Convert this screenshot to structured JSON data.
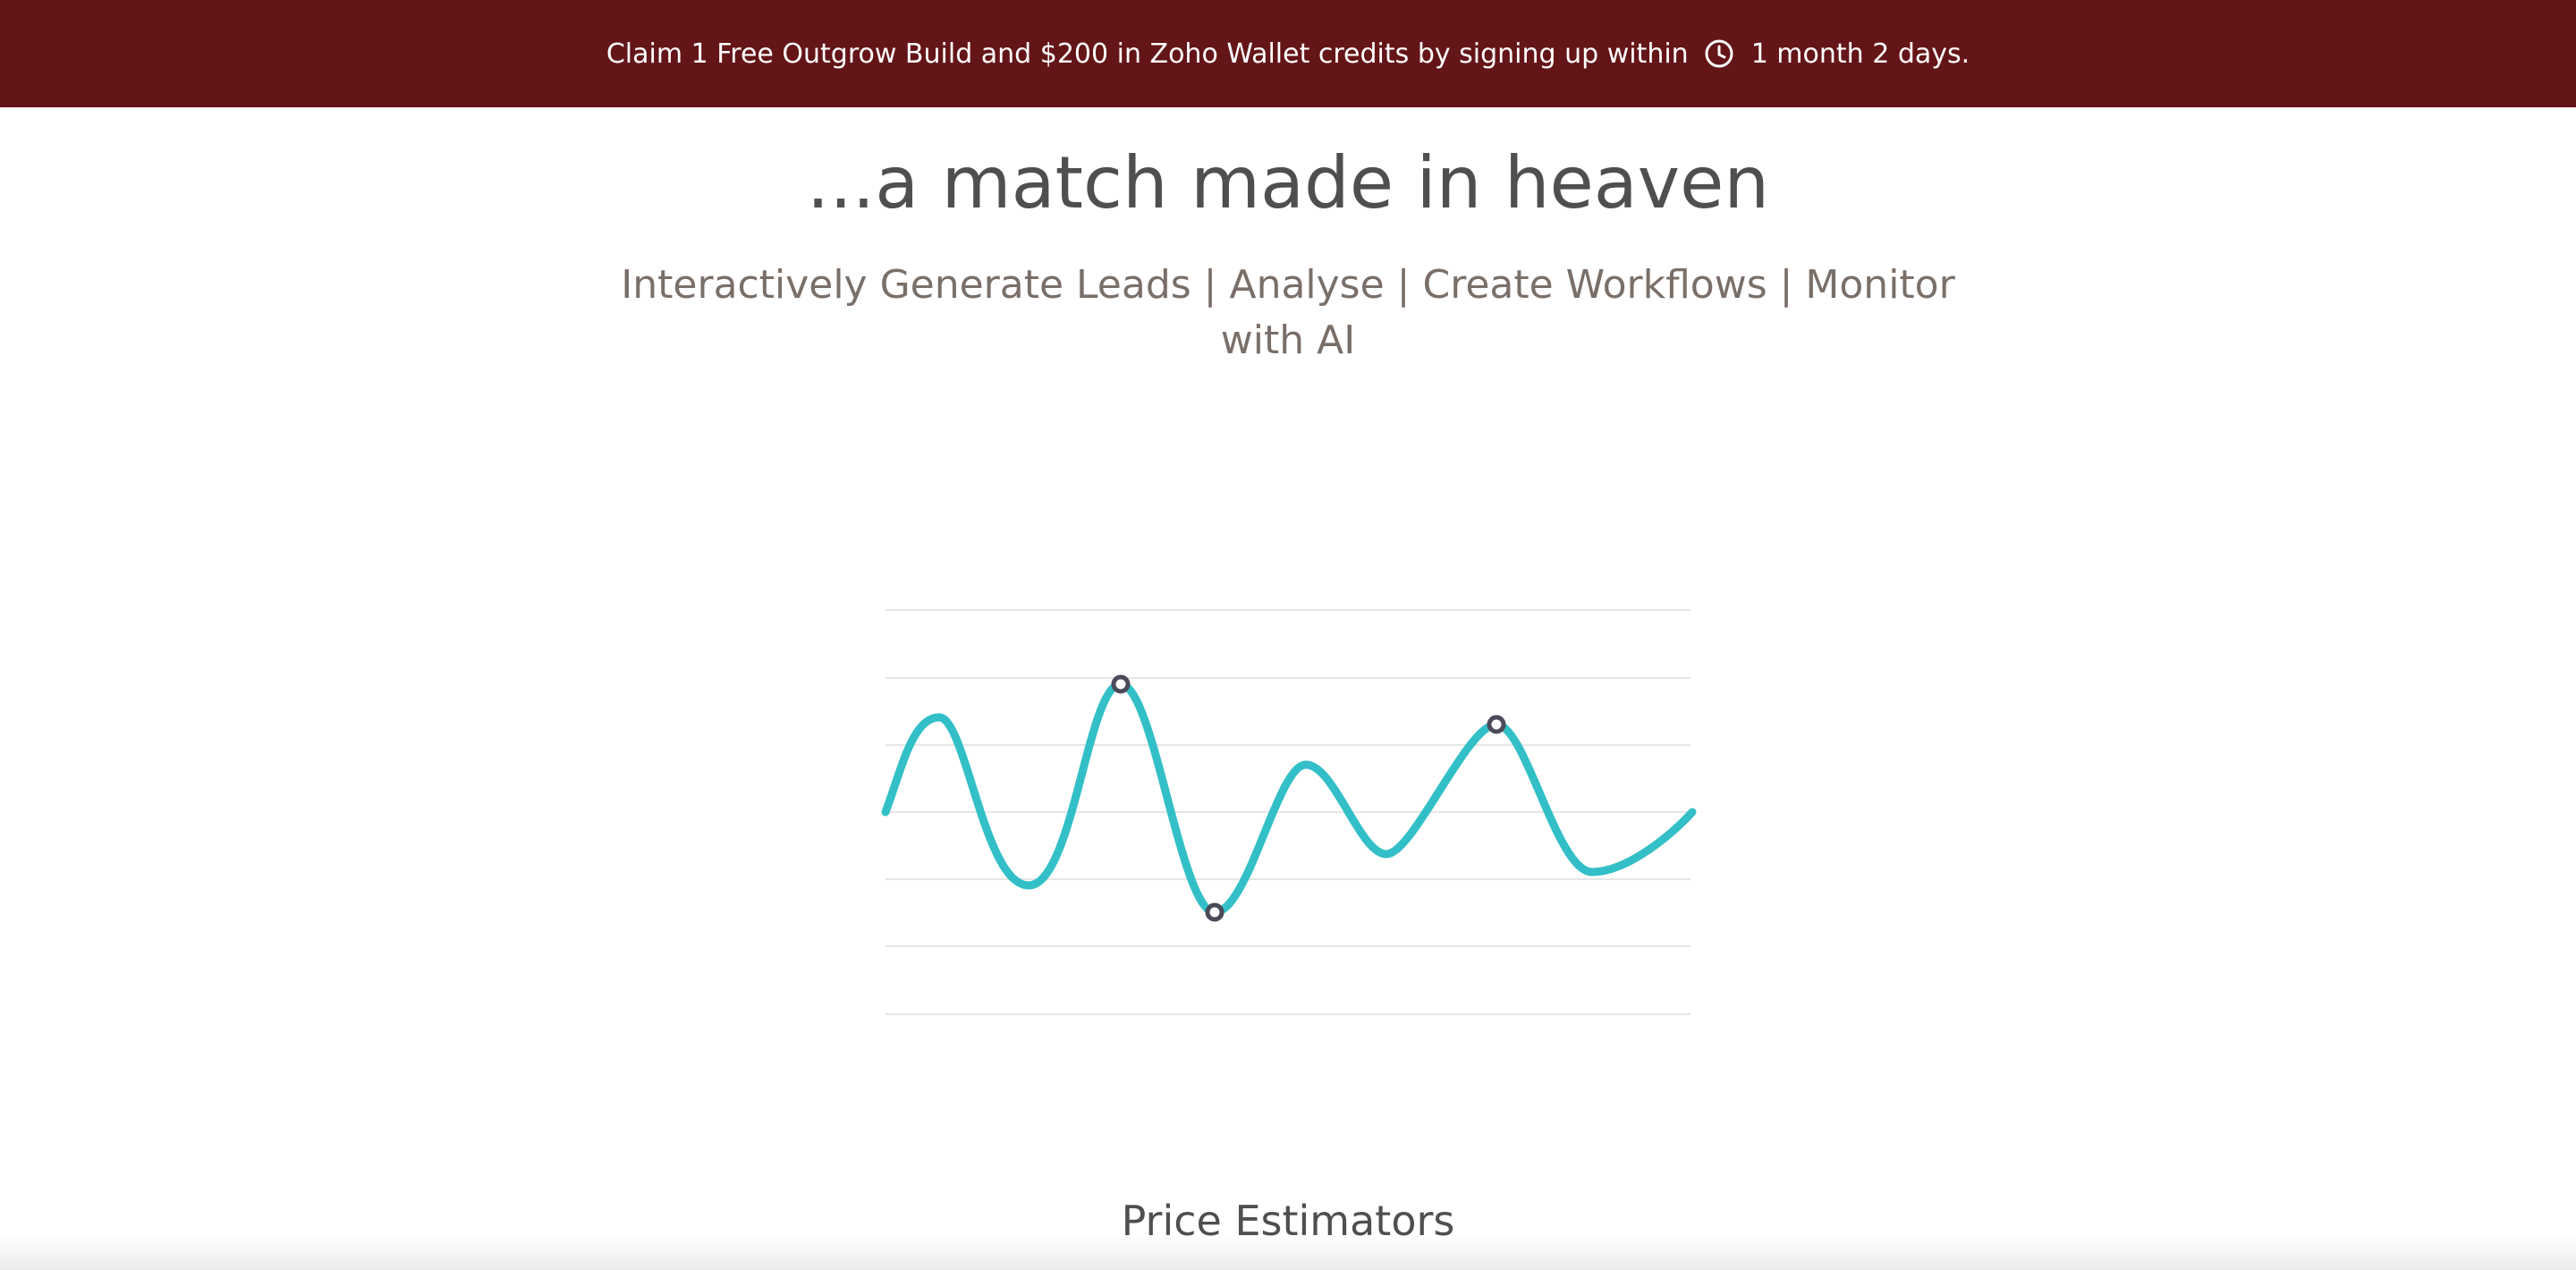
{
  "banner": {
    "text": "Claim 1 Free Outgrow Build and $200 in Zoho Wallet credits by signing up within",
    "countdown": "1 month 2 days.",
    "icon": "clock-icon",
    "background": "#641517"
  },
  "hero": {
    "headline": "...a match made in heaven",
    "subtitle": "Interactively Generate Leads | Analyse | Create Workflows | Monitor with AI"
  },
  "illustration": {
    "line_color": "#33bfc7",
    "marker_color": "#4a4a5a",
    "grid_color": "#e6e6e6"
  },
  "section": {
    "title": "Price Estimators"
  }
}
